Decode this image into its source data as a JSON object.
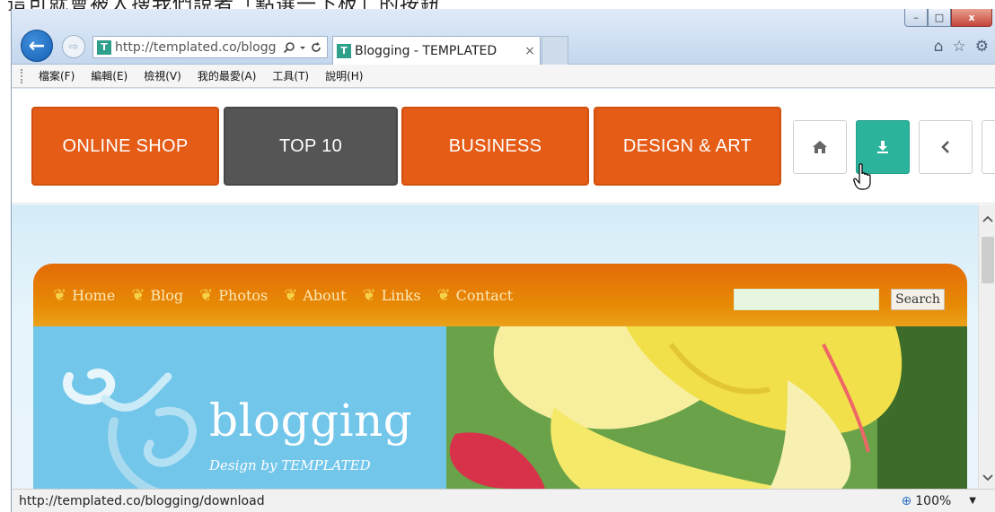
{
  "caption_partial": "這可就會被人搜我們說者「點選一下板」的按鈕",
  "browser": {
    "window_controls": {
      "minimize": "–",
      "maximize": "□",
      "close": "x"
    },
    "address_url": "http://templated.co/blogg",
    "search_icon": "search-icon",
    "tab_title": "Blogging - TEMPLATED",
    "tab_close": "×",
    "favicon_letter": "T",
    "back_glyph": "←",
    "forward_glyph": "⇨",
    "right_icons": [
      "⌂",
      "☆",
      "⚙"
    ]
  },
  "menu": {
    "items": [
      "檔案(F)",
      "編輯(E)",
      "檢視(V)",
      "我的最愛(A)",
      "工具(T)",
      "說明(H)"
    ]
  },
  "demo_bar": {
    "buttons": [
      {
        "label": "ONLINE SHOP",
        "color": "#e55c17"
      },
      {
        "label": "TOP 10",
        "color": "#555555"
      },
      {
        "label": "BUSINESS",
        "color": "#e55c17"
      },
      {
        "label": "DESIGN & ART",
        "color": "#e55c17"
      }
    ],
    "icon_buttons": [
      {
        "icon": "home-icon",
        "glyph": "⌂"
      },
      {
        "icon": "download-icon",
        "glyph": "⤓",
        "accent": "#2bb39b"
      },
      {
        "icon": "chevron-left-icon",
        "glyph": "‹"
      }
    ]
  },
  "site": {
    "nav": [
      "Home",
      "Blog",
      "Photos",
      "About",
      "Links",
      "Contact"
    ],
    "search_button": "Search",
    "hero_title": "blogging",
    "hero_subtitle": "Design by TEMPLATED"
  },
  "status": {
    "url": "http://templated.co/blogging/download",
    "zoom": "100%"
  }
}
